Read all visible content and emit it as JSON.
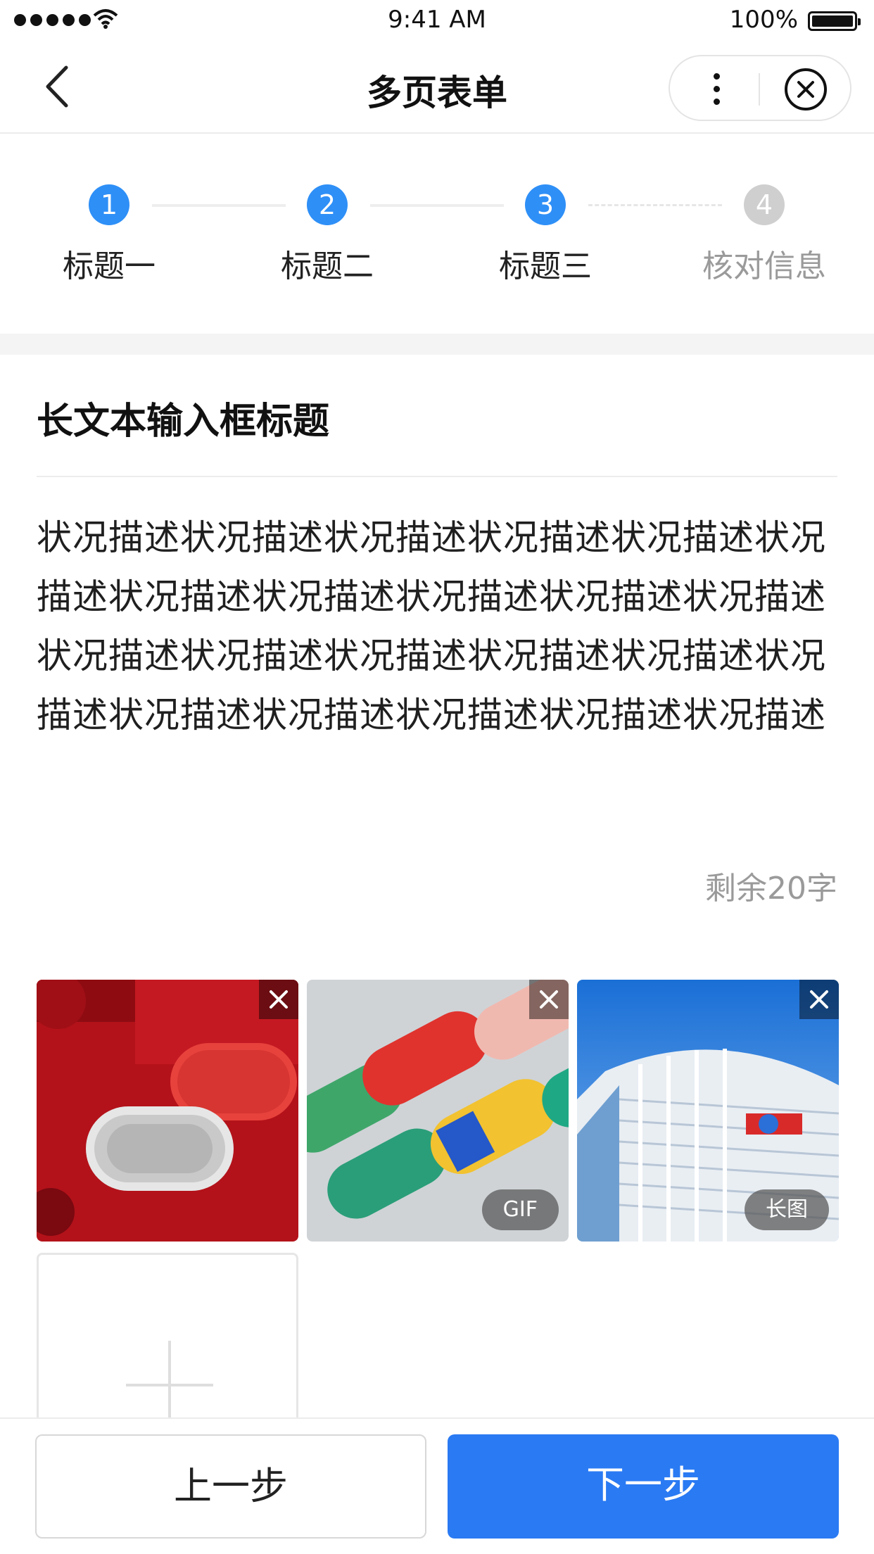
{
  "status_bar": {
    "time": "9:41 AM",
    "battery": "100%"
  },
  "nav": {
    "title": "多页表单"
  },
  "steps": [
    {
      "num": "1",
      "label": "标题一",
      "state": "done"
    },
    {
      "num": "2",
      "label": "标题二",
      "state": "done"
    },
    {
      "num": "3",
      "label": "标题三",
      "state": "active"
    },
    {
      "num": "4",
      "label": "核对信息",
      "state": "pending"
    }
  ],
  "form": {
    "title": "长文本输入框标题",
    "value": "状况描述状况描述状况描述状况描述状况描述状况描述状况描述状况描述状况描述状况描述状况描述状况描述状况描述状况描述状况描述状况描述状况描述状况描述状况描述状况描述状况描述状况描述",
    "remaining": "剩余20字"
  },
  "images": [
    {
      "name": "red-speaker",
      "tag": ""
    },
    {
      "name": "pattern-speakers",
      "tag": "GIF"
    },
    {
      "name": "building",
      "tag": "长图"
    }
  ],
  "footer": {
    "prev_label": "上一步",
    "next_label": "下一步"
  },
  "colors": {
    "primary": "#2a7af3",
    "step_active": "#2e8ff7",
    "step_pending": "#cfcfcf",
    "muted_text": "#9a9a9a"
  }
}
